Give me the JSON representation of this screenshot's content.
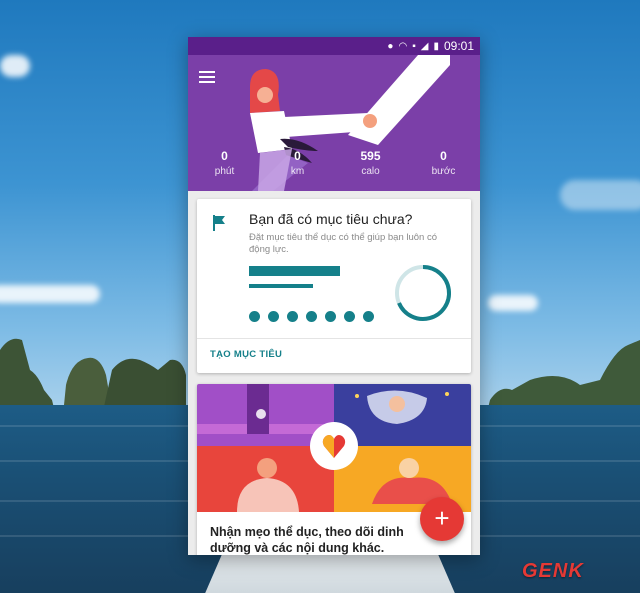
{
  "status_bar": {
    "time": "09:01"
  },
  "stats": [
    {
      "value": "0",
      "label": "phút"
    },
    {
      "value": "0",
      "label": "km"
    },
    {
      "value": "595",
      "label": "calo"
    },
    {
      "value": "0",
      "label": "bước"
    }
  ],
  "goal_card": {
    "title": "Bạn đã có mục tiêu chưa?",
    "subtitle": "Đặt mục tiêu thể dục có thể giúp bạn luôn có động lực.",
    "action_label": "TẠO MỤC TIÊU"
  },
  "tips_card": {
    "text": "Nhận mẹo thể dục, theo dõi dinh dưỡng và các nội dung khác."
  },
  "fab": {
    "icon": "+"
  },
  "watermark": {
    "brand": "GENK"
  },
  "colors": {
    "header": "#7b3fa8",
    "statusbar": "#5a1f8a",
    "accent": "#15808a",
    "fab": "#e53935"
  }
}
